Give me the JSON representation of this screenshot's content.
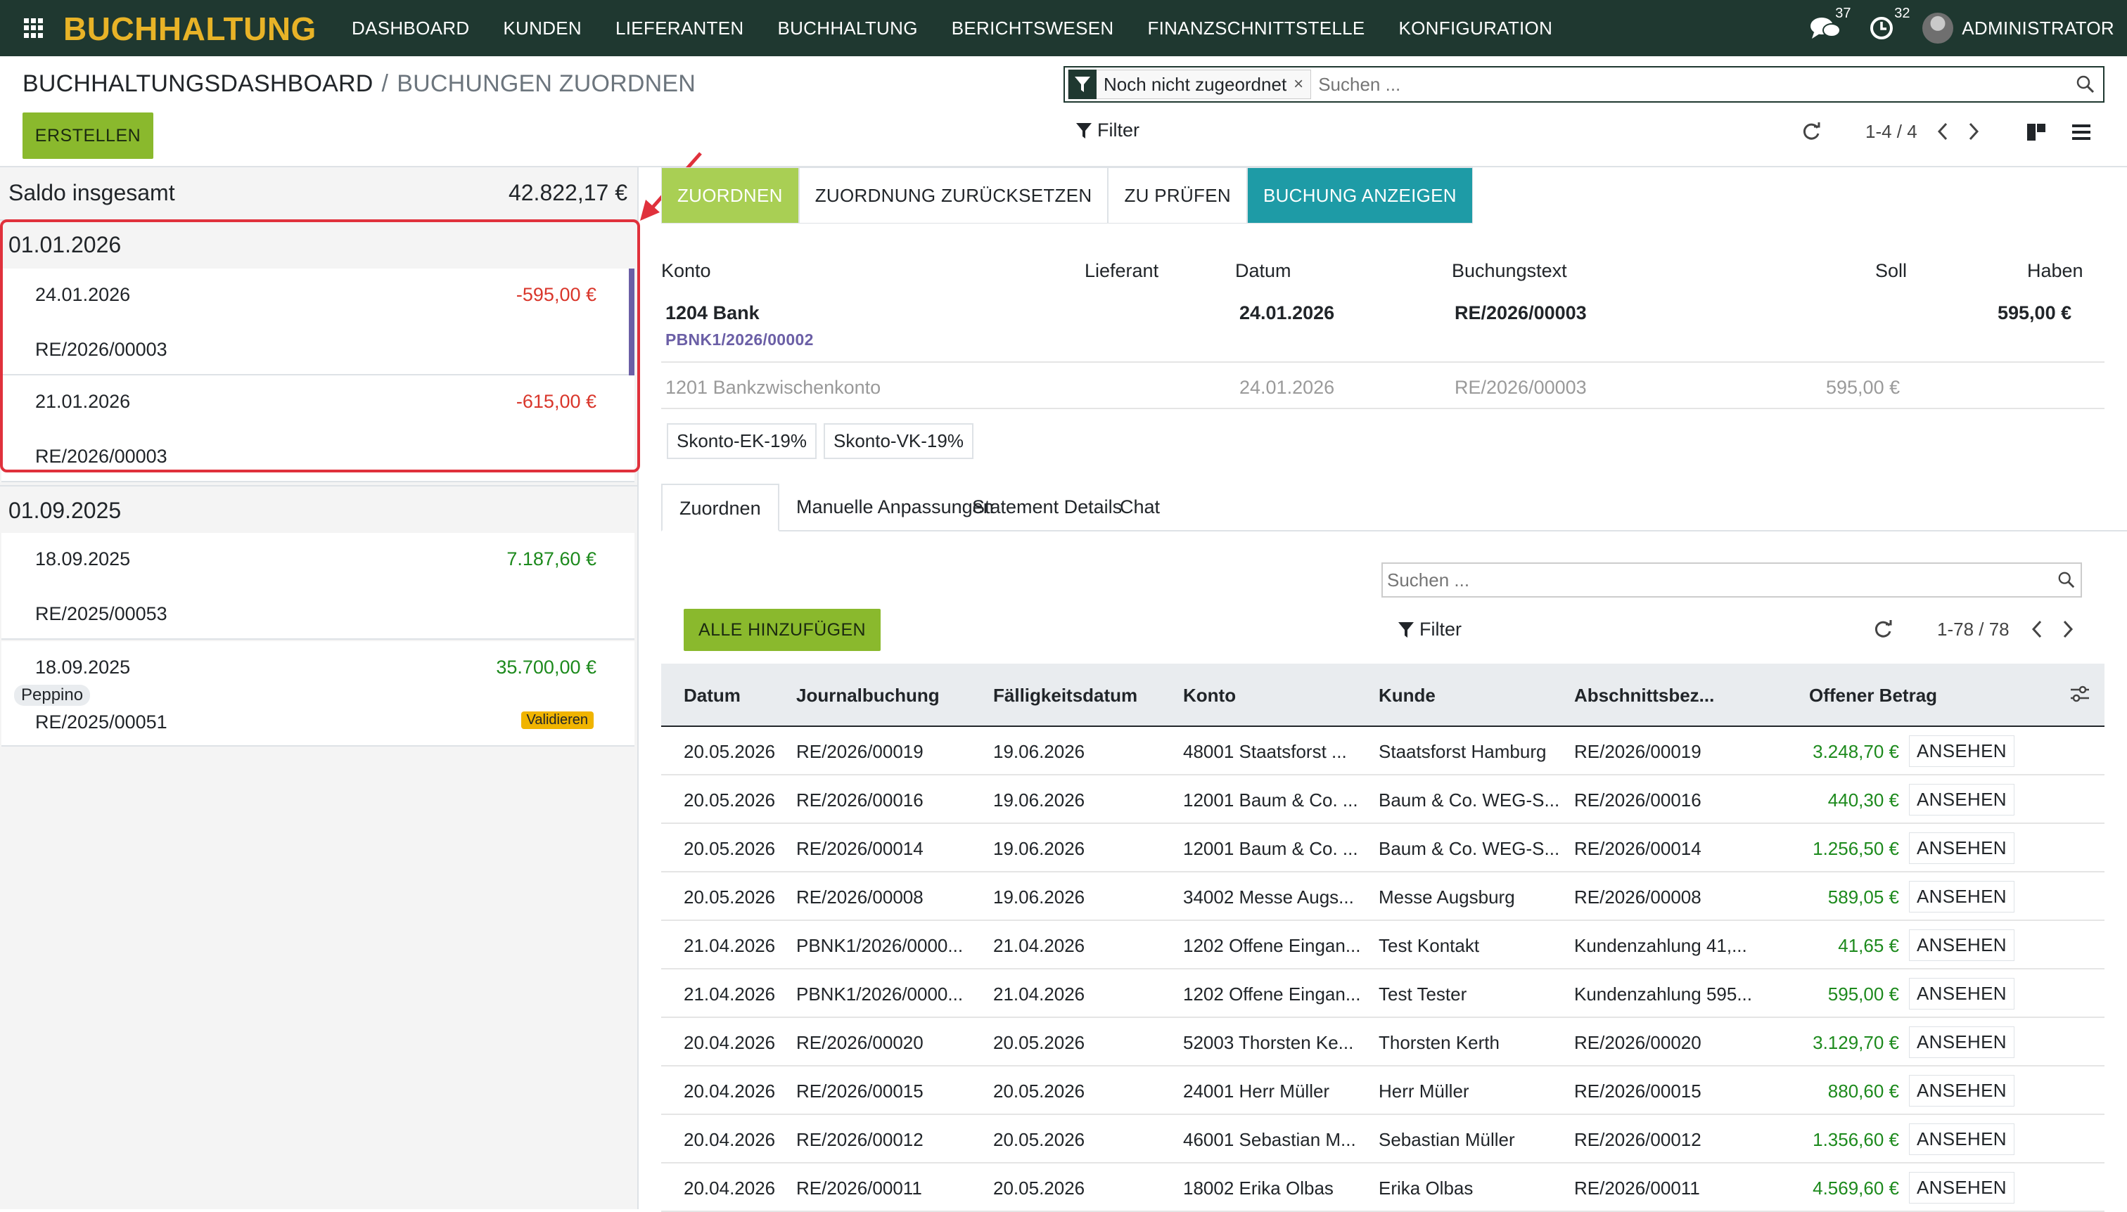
{
  "app": {
    "brand": "BUCHHALTUNG",
    "menu": [
      "DASHBOARD",
      "KUNDEN",
      "LIEFERANTEN",
      "BUCHHALTUNG",
      "BERICHTSWESEN",
      "FINANZSCHNITTSTELLE",
      "KONFIGURATION"
    ],
    "messages_count": "37",
    "activities_count": "32",
    "user": "ADMINISTRATOR"
  },
  "control": {
    "breadcrumb_root": "BUCHHALTUNGSDASHBOARD",
    "breadcrumb_sep": "/",
    "breadcrumb_current": "BUCHUNGEN ZUORDNEN",
    "create_label": "ERSTELLEN",
    "facet_label": "Noch nicht zugeordnet",
    "facet_close": "×",
    "search_placeholder": "Suchen ...",
    "filter_label": "Filter",
    "pager": "1-4 / 4"
  },
  "left": {
    "saldo_label": "Saldo insgesamt",
    "saldo_value": "42.822,17 €",
    "groups": [
      {
        "date": "01.01.2026",
        "items": [
          {
            "date": "24.01.2026",
            "amount": "-595,00 €",
            "ref": "RE/2026/00003"
          },
          {
            "date": "21.01.2026",
            "amount": "-615,00 €",
            "ref": "RE/2026/00003"
          }
        ]
      },
      {
        "date": "01.09.2025",
        "items": [
          {
            "date": "18.09.2025",
            "amount": "7.187,60 €",
            "ref": "RE/2025/00053"
          },
          {
            "date": "18.09.2025",
            "amount": "35.700,00 €",
            "ref": "RE/2025/00051",
            "partner": "Peppino",
            "badge": "Validieren"
          }
        ]
      }
    ]
  },
  "actions": {
    "assign": "ZUORDNEN",
    "reset": "ZUORDNUNG ZURÜCKSETZEN",
    "review": "ZU PRÜFEN",
    "show": "BUCHUNG ANZEIGEN"
  },
  "statement": {
    "headers": {
      "konto": "Konto",
      "lieferant": "Lieferant",
      "datum": "Datum",
      "text": "Buchungstext",
      "soll": "Soll",
      "haben": "Haben"
    },
    "main": {
      "konto": "1204 Bank",
      "sub": "PBNK1/2026/00002",
      "datum": "24.01.2026",
      "text": "RE/2026/00003",
      "haben": "595,00 €"
    },
    "counter": {
      "konto": "1201 Bankzwischenkonto",
      "datum": "24.01.2026",
      "text": "RE/2026/00003",
      "soll": "595,00 €"
    },
    "models": [
      "Skonto-EK-19%",
      "Skonto-VK-19%"
    ]
  },
  "tabs": [
    "Zuordnen",
    "Manuelle Anpassungen",
    "Statement Details",
    "Chat"
  ],
  "sub": {
    "search_placeholder": "Suchen ...",
    "add_all": "ALLE HINZUFÜGEN",
    "filter_label": "Filter",
    "pager": "1-78 / 78"
  },
  "table": {
    "headers": [
      "Datum",
      "Journalbuchung",
      "Fälligkeitsdatum",
      "Konto",
      "Kunde",
      "Abschnittsbez...",
      "Offener Betrag"
    ],
    "view_label": "ANSEHEN",
    "rows": [
      [
        "20.05.2026",
        "RE/2026/00019",
        "19.06.2026",
        "48001 Staatsforst ...",
        "Staatsforst Hamburg",
        "RE/2026/00019",
        "3.248,70 €"
      ],
      [
        "20.05.2026",
        "RE/2026/00016",
        "19.06.2026",
        "12001 Baum & Co. ...",
        "Baum & Co. WEG-S...",
        "RE/2026/00016",
        "440,30 €"
      ],
      [
        "20.05.2026",
        "RE/2026/00014",
        "19.06.2026",
        "12001 Baum & Co. ...",
        "Baum & Co. WEG-S...",
        "RE/2026/00014",
        "1.256,50 €"
      ],
      [
        "20.05.2026",
        "RE/2026/00008",
        "19.06.2026",
        "34002 Messe Augs...",
        "Messe Augsburg",
        "RE/2026/00008",
        "589,05 €"
      ],
      [
        "21.04.2026",
        "PBNK1/2026/0000...",
        "21.04.2026",
        "1202 Offene Eingan...",
        "Test Kontakt",
        "Kundenzahlung 41,...",
        "41,65 €"
      ],
      [
        "21.04.2026",
        "PBNK1/2026/0000...",
        "21.04.2026",
        "1202 Offene Eingan...",
        "Test Tester",
        "Kundenzahlung 595...",
        "595,00 €"
      ],
      [
        "20.04.2026",
        "RE/2026/00020",
        "20.05.2026",
        "52003 Thorsten Ke...",
        "Thorsten Kerth",
        "RE/2026/00020",
        "3.129,70 €"
      ],
      [
        "20.04.2026",
        "RE/2026/00015",
        "20.05.2026",
        "24001 Herr Müller",
        "Herr Müller",
        "RE/2026/00015",
        "880,60 €"
      ],
      [
        "20.04.2026",
        "RE/2026/00012",
        "20.05.2026",
        "46001 Sebastian M...",
        "Sebastian Müller",
        "RE/2026/00012",
        "1.356,60 €"
      ],
      [
        "20.04.2026",
        "RE/2026/00011",
        "20.05.2026",
        "18002 Erika Olbas",
        "Erika Olbas",
        "RE/2026/00011",
        "4.569,60 €"
      ]
    ]
  }
}
